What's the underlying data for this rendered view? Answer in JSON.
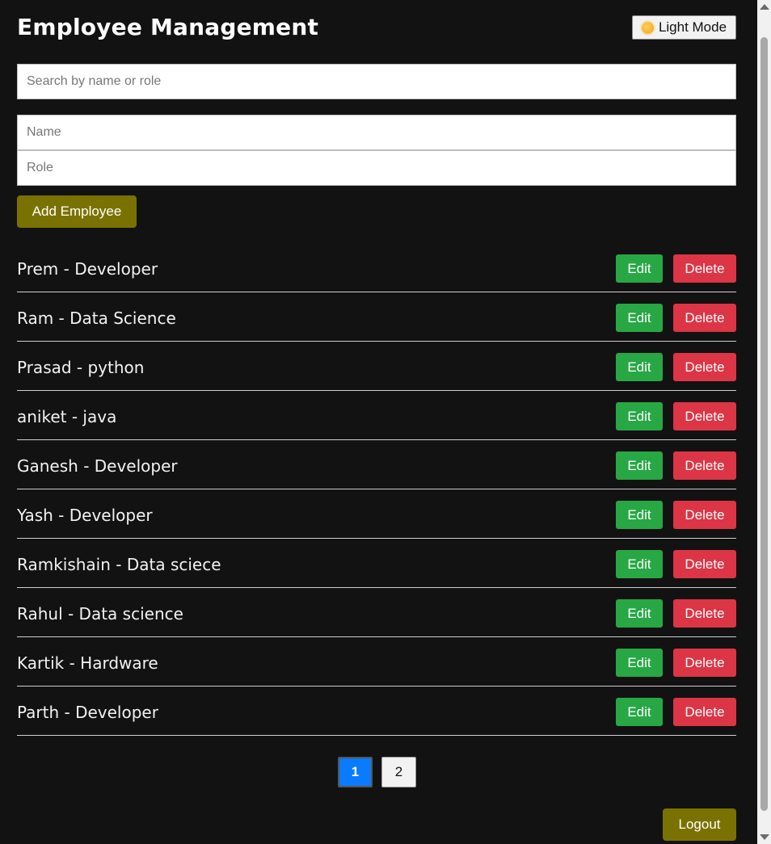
{
  "header": {
    "title": "Employee Management",
    "mode_button": {
      "label": "Light Mode",
      "icon": "sun-icon"
    }
  },
  "search": {
    "placeholder": "Search by name or role",
    "value": ""
  },
  "form": {
    "name_placeholder": "Name",
    "role_placeholder": "Role",
    "add_label": "Add Employee"
  },
  "employees": [
    {
      "label": "Prem - Developer",
      "edit": "Edit",
      "delete": "Delete"
    },
    {
      "label": "Ram - Data Science",
      "edit": "Edit",
      "delete": "Delete"
    },
    {
      "label": "Prasad - python",
      "edit": "Edit",
      "delete": "Delete"
    },
    {
      "label": "aniket - java",
      "edit": "Edit",
      "delete": "Delete"
    },
    {
      "label": "Ganesh - Developer",
      "edit": "Edit",
      "delete": "Delete"
    },
    {
      "label": "Yash - Developer",
      "edit": "Edit",
      "delete": "Delete"
    },
    {
      "label": "Ramkishain - Data sciece",
      "edit": "Edit",
      "delete": "Delete"
    },
    {
      "label": "Rahul - Data science",
      "edit": "Edit",
      "delete": "Delete"
    },
    {
      "label": "Kartik - Hardware",
      "edit": "Edit",
      "delete": "Delete"
    },
    {
      "label": "Parth - Developer",
      "edit": "Edit",
      "delete": "Delete"
    }
  ],
  "pagination": {
    "pages": [
      "1",
      "2"
    ],
    "current": "1"
  },
  "footer": {
    "logout_label": "Logout"
  },
  "colors": {
    "background": "#121212",
    "olive_button": "#7a7200",
    "edit_green": "#28a745",
    "delete_red": "#dc3545",
    "active_page_blue": "#0a7bff"
  }
}
